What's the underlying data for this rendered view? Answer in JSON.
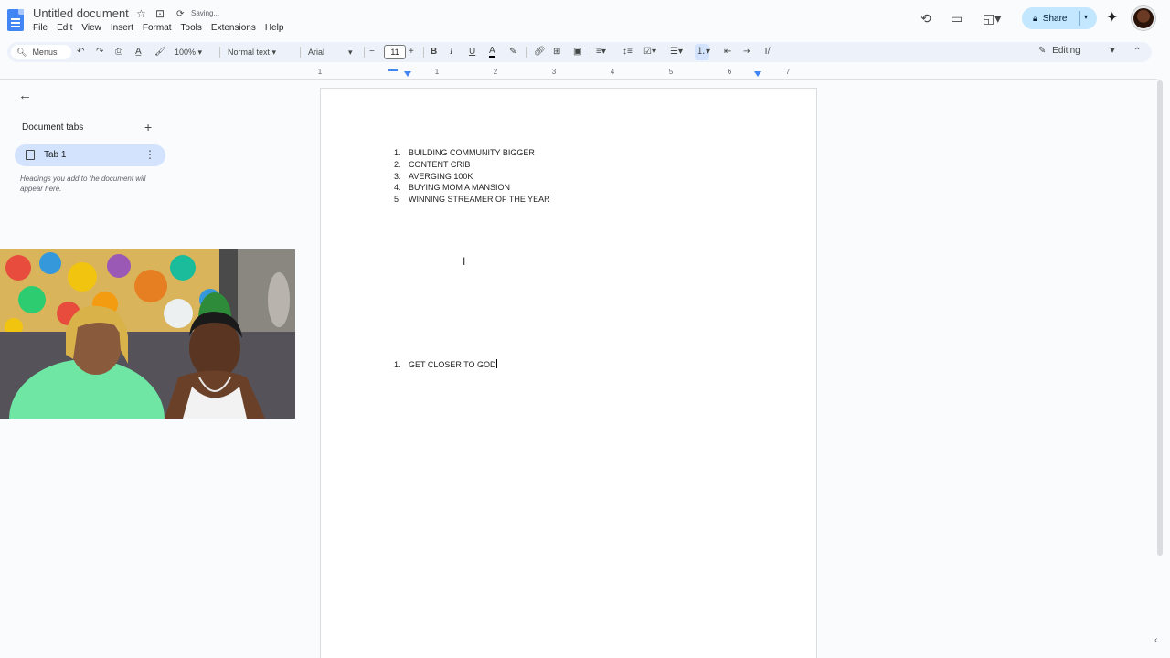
{
  "doc": {
    "title": "Untitled document",
    "status": "Saving...",
    "menus": [
      "File",
      "Edit",
      "View",
      "Insert",
      "Format",
      "Tools",
      "Extensions",
      "Help"
    ]
  },
  "header": {
    "share_label": "Share"
  },
  "toolbar": {
    "menus_label": "Menus",
    "zoom": "100%",
    "style": "Normal text",
    "font": "Arial",
    "font_size": "11",
    "mode": "Editing"
  },
  "ruler": {
    "numbers": [
      "1",
      "1",
      "2",
      "3",
      "4",
      "5",
      "6",
      "7"
    ]
  },
  "sidebar": {
    "title": "Document tabs",
    "tab_label": "Tab 1",
    "hint": "Headings you add to the document will appear here."
  },
  "document": {
    "list1": [
      {
        "num": "1.",
        "text": "BUILDING COMMUNITY BIGGER"
      },
      {
        "num": "2.",
        "text": "CONTENT CRIB"
      },
      {
        "num": "3.",
        "text": "AVERGING 100K"
      },
      {
        "num": "4.",
        "text": "BUYING MOM A MANSION"
      },
      {
        "num": "5",
        "text": "WINNING STREAMER OF THE YEAR"
      }
    ],
    "list2": [
      {
        "num": "1.",
        "text": "GET CLOSER TO GOD"
      }
    ]
  }
}
